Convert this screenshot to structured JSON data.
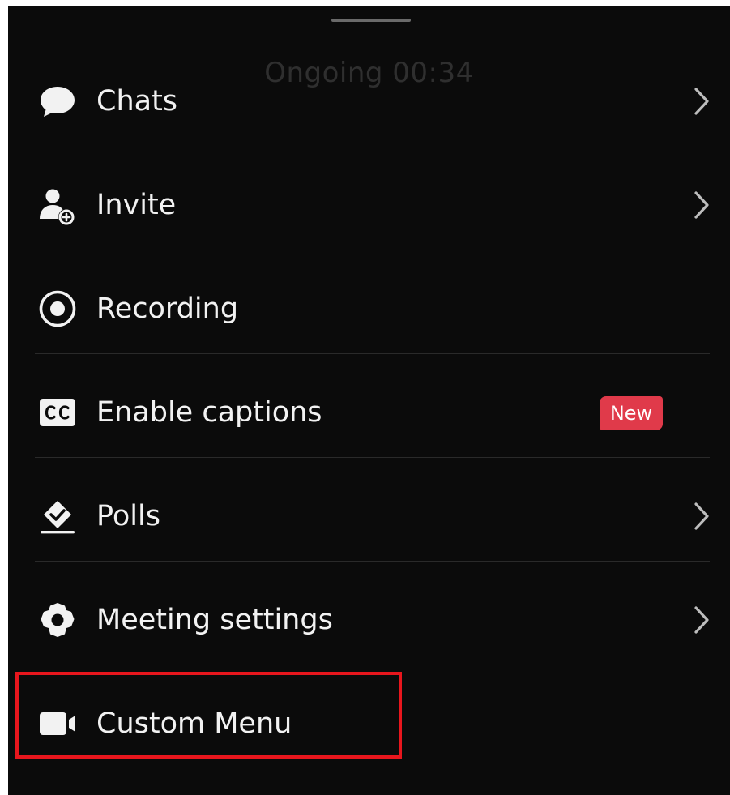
{
  "header": {
    "status_text": "Ongoing 00:34"
  },
  "menu": {
    "items": [
      {
        "label": "Chats",
        "icon": "chat-bubble-icon",
        "has_chevron": true
      },
      {
        "label": "Invite",
        "icon": "add-user-icon",
        "has_chevron": true
      },
      {
        "label": "Recording",
        "icon": "record-icon",
        "has_chevron": false
      },
      {
        "label": "Enable captions",
        "icon": "closed-captions-icon",
        "has_chevron": false,
        "badge": "New"
      },
      {
        "label": "Polls",
        "icon": "poll-check-icon",
        "has_chevron": true
      },
      {
        "label": "Meeting settings",
        "icon": "gear-icon",
        "has_chevron": true
      },
      {
        "label": "Custom Menu",
        "icon": "video-camera-icon",
        "has_chevron": false
      }
    ]
  },
  "colors": {
    "background": "#0b0b0b",
    "text": "#f2f2f2",
    "badge": "#e03a4a",
    "highlight": "#e8161d",
    "divider": "#2a2a2a"
  }
}
